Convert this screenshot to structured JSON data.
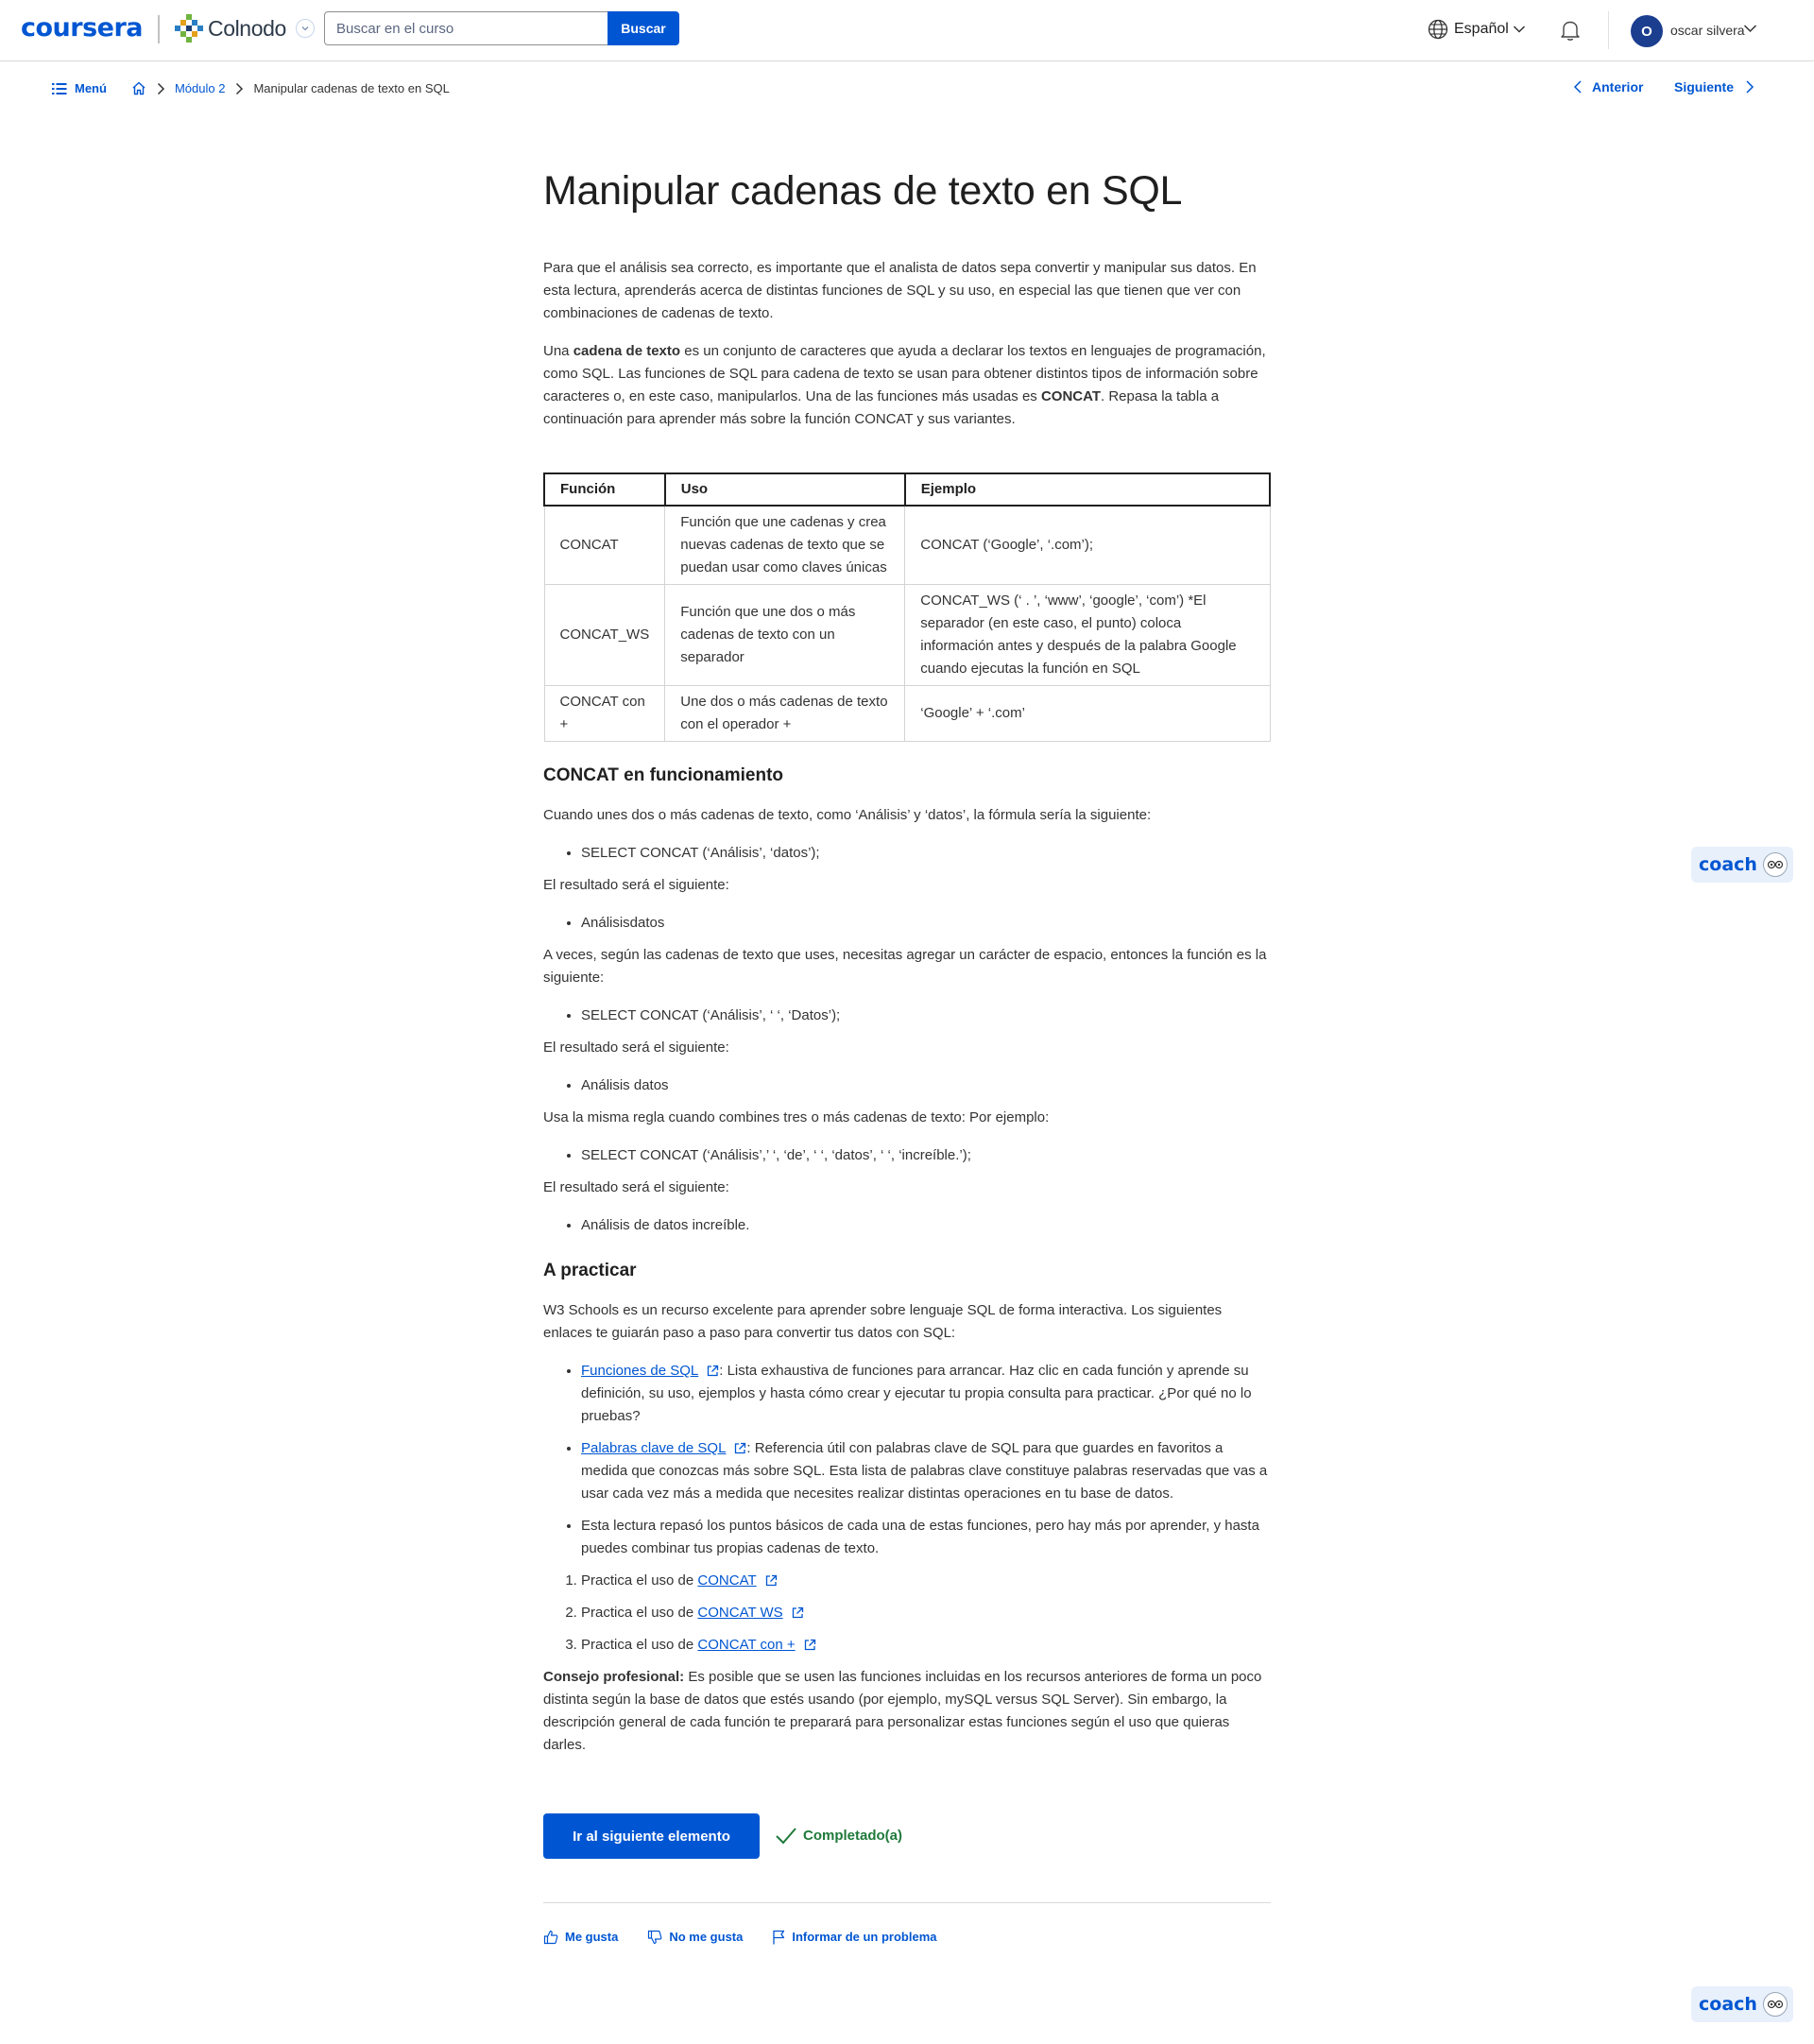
{
  "header": {
    "logo": "coursera",
    "partner_name": "Colnodo",
    "search_placeholder": "Buscar en el curso",
    "search_button": "Buscar",
    "language": "Español",
    "user_initial": "O",
    "user_name": "oscar silvera"
  },
  "breadcrumb": {
    "menu": "Menú",
    "module": "Módulo 2",
    "current": "Manipular cadenas de texto en SQL",
    "prev": "Anterior",
    "next": "Siguiente"
  },
  "article": {
    "title": "Manipular cadenas de texto en SQL",
    "intro": "Para que el análisis sea correcto, es importante que el analista de datos sepa convertir y manipular sus datos. En esta lectura, aprenderás acerca de distintas funciones de SQL y su uso, en especial las que tienen que ver con combinaciones de cadenas de texto.",
    "p2_a": "Una ",
    "p2_bold1": "cadena de texto",
    "p2_b": " es un conjunto de caracteres que ayuda a declarar los textos en lenguajes de programación, como SQL. Las funciones de SQL para cadena de texto se usan para obtener distintos tipos de información sobre caracteres o, en este caso, manipularlos. Una de las funciones más usadas es ",
    "p2_bold2": "CONCAT",
    "p2_c": ". Repasa la tabla a continuación para aprender más sobre la función CONCAT y sus variantes.",
    "table": {
      "headers": [
        "Función",
        "Uso",
        "Ejemplo"
      ],
      "rows": [
        [
          "CONCAT",
          "Función que une cadenas y crea nuevas cadenas de texto que se puedan usar como claves únicas",
          "CONCAT (‘Google’, ‘.com’);"
        ],
        [
          "CONCAT_WS",
          "Función que une dos o más cadenas de texto con un separador",
          "CONCAT_WS (‘ . ’, ‘www’, ‘google’, ‘com’) *El separador (en este caso, el punto) coloca información antes y después de la palabra Google cuando ejecutas la función en SQL"
        ],
        [
          "CONCAT con +",
          "Une dos o más cadenas de texto con el operador +",
          "‘Google’ + ‘.com’"
        ]
      ]
    },
    "h_concat": "CONCAT en funcionamiento",
    "c1": "Cuando unes dos o más cadenas de texto, como ‘Análisis’ y ‘datos’, la fórmula sería la siguiente:",
    "c1_li": "SELECT CONCAT (‘Análisis’, ‘datos’);",
    "result_label": "El resultado será el siguiente:",
    "c2_li": "Análisisdatos",
    "c3": "A veces, según las cadenas de texto que uses, necesitas agregar un carácter de espacio, entonces la función es la siguiente:",
    "c3_li": "SELECT CONCAT (‘Análisis’, ‘ ‘, ‘Datos’);",
    "c4_li": "Análisis datos",
    "c5": "Usa la misma regla cuando combines tres o más cadenas de texto: Por ejemplo:",
    "c5_li": "SELECT CONCAT (‘Análisis’,’ ‘, ‘de’, ‘ ‘, ‘datos’, ‘ ‘, ‘increíble.’);",
    "c6_li": "Análisis de datos increíble.",
    "h_practice": "A practicar",
    "pr_intro": "W3 Schools es un recurso excelente para aprender sobre lenguaje SQL de forma interactiva. Los siguientes enlaces te guiarán paso a paso para convertir tus datos con SQL:",
    "pr_li1_link": "Funciones de SQL",
    "pr_li1_text": ": Lista exhaustiva de funciones para arrancar. Haz clic en cada función y aprende su definición, su uso, ejemplos y hasta cómo crear y ejecutar tu propia consulta para practicar. ¿Por qué no lo pruebas?",
    "pr_li2_link": "Palabras clave de SQL",
    "pr_li2_text": ": Referencia útil con palabras clave de SQL para que guardes en favoritos a medida que conozcas más sobre SQL. Esta lista de palabras clave constituye palabras reservadas que vas a usar cada vez más a medida que necesites realizar distintas operaciones en tu base de datos.",
    "pr_li3_text": "Esta lectura repasó los puntos básicos de cada una de estas funciones, pero hay más por aprender, y hasta puedes combinar tus propias cadenas de texto.",
    "ol_prefix": "Practica el uso de ",
    "ol_links": [
      "CONCAT",
      "CONCAT WS",
      "CONCAT con +"
    ],
    "tip_bold": "Consejo profesional:",
    "tip_text": " Es posible que se usen las funciones incluidas en los recursos anteriores de forma un poco distinta según la base de datos que estés usando (por ejemplo, mySQL versus SQL Server). Sin embargo, la descripción general de cada función te preparará para personalizar estas funciones según el uso que quieras darles."
  },
  "actions": {
    "next_item": "Ir al siguiente elemento",
    "completed": "Completado(a)",
    "like": "Me gusta",
    "dislike": "No me gusta",
    "report": "Informar de un problema"
  },
  "coach": {
    "label": "coach"
  },
  "colors": {
    "brand": "#0056d2",
    "completed": "#1f7a3a"
  }
}
